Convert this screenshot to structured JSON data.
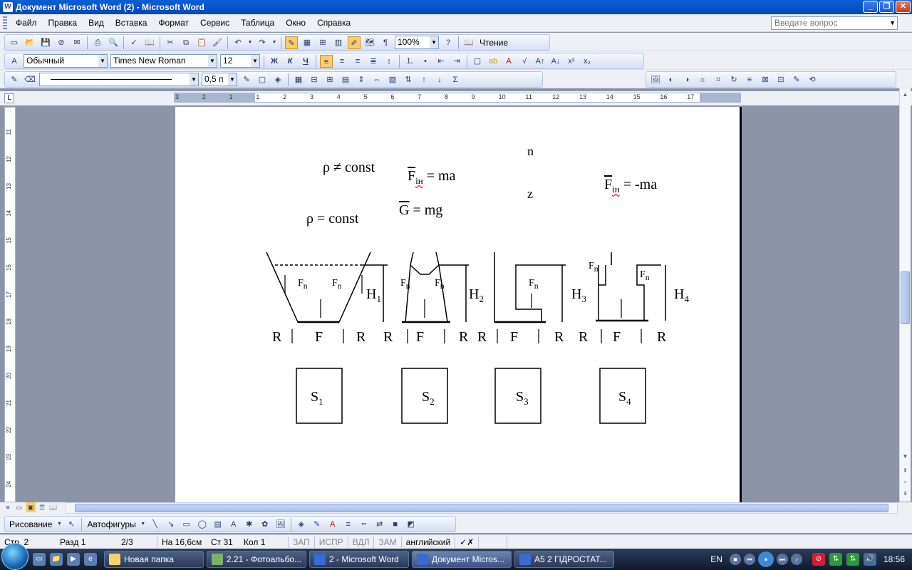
{
  "window": {
    "title": "Документ Microsoft Word (2) - Microsoft Word",
    "buttons": [
      "_",
      "❐",
      "✕"
    ]
  },
  "menubar": {
    "items": [
      "Файл",
      "Правка",
      "Вид",
      "Вставка",
      "Формат",
      "Сервис",
      "Таблица",
      "Окно",
      "Справка"
    ],
    "ask_placeholder": "Введите вопрос"
  },
  "toolbar_standard": {
    "zoom": "100%",
    "reading_label": "Чтение"
  },
  "toolbar_formatting": {
    "style": "Обычный",
    "font": "Times New Roman",
    "size": "12",
    "bold": "Ж",
    "italic": "К",
    "underline": "Ч"
  },
  "toolbar_tables": {
    "line_weight": "0,5 п"
  },
  "ruler": {
    "labels": [
      "3",
      "2",
      "1",
      "1",
      "2",
      "3",
      "4",
      "5",
      "6",
      "7",
      "8",
      "9",
      "10",
      "11",
      "12",
      "13",
      "14",
      "15",
      "16",
      "17"
    ],
    "vlabels": [
      "11",
      "12",
      "13",
      "14",
      "15",
      "16",
      "17",
      "18",
      "19",
      "20",
      "21",
      "22",
      "23",
      "24"
    ]
  },
  "document": {
    "eq1": "ρ ≠ const",
    "eq2_lhs": "F",
    "eq2_sub": "ін",
    "eq2_rhs": " = ma",
    "eq3": "n",
    "eq4_lhs": "F",
    "eq4_sub": "ін",
    "eq4_rhs": " = -ma",
    "eq5": "z",
    "eq6_lhs": "G",
    "eq6_rhs": " = mg",
    "eq7": "ρ = const",
    "vessels": [
      {
        "F": "F",
        "H": "H",
        "H_sub": "1",
        "S": "S",
        "S_sub": "1"
      },
      {
        "F": "F",
        "H": "H",
        "H_sub": "2",
        "S": "S",
        "S_sub": "2"
      },
      {
        "F": "F",
        "H": "H",
        "H_sub": "3",
        "S": "S",
        "S_sub": "3"
      },
      {
        "F": "F",
        "H": "H",
        "H_sub": "4",
        "S": "S",
        "S_sub": "4"
      }
    ],
    "fn_label": "F",
    "fn_sub": "n",
    "r_label": "R"
  },
  "drawing_toolbar": {
    "draw_label": "Рисование",
    "autoshapes_label": "Автофигуры"
  },
  "statusbar": {
    "page": "Стр. 2",
    "section": "Разд 1",
    "pages": "2/3",
    "at": "На 16,6см",
    "line": "Ст 31",
    "col": "Кол 1",
    "rec": "ЗАП",
    "trk": "ИСПР",
    "ext": "ВДЛ",
    "ovr": "ЗАМ",
    "lang": "английский"
  },
  "taskbar": {
    "tasks": [
      "Новая папка",
      "2.21 - Фотоальбо...",
      "2 - Microsoft Word",
      "Документ Micros...",
      "А5 2 ГІДРОСТАТ..."
    ],
    "lang": "EN",
    "clock": "18:56"
  }
}
